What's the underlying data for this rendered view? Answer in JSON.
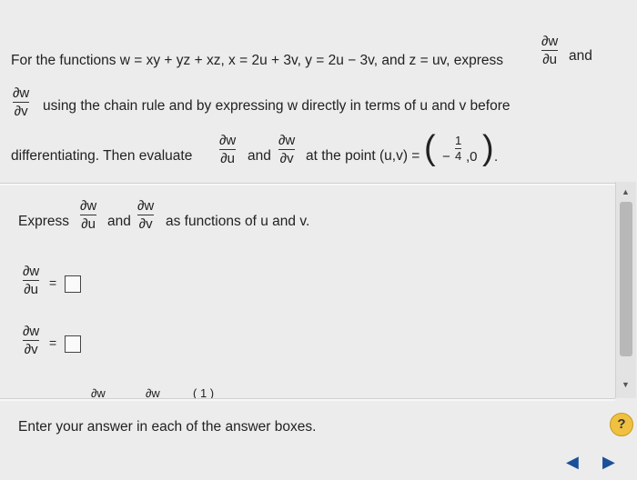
{
  "question": {
    "line1": "For the functions w = xy + yz + xz, x = 2u + 3v, y = 2u − 3v, and z = uv, express",
    "and1": "and",
    "line2": "using the chain rule and by expressing w directly in terms of u and v before",
    "line3_prefix": "differentiating. Then evaluate",
    "and2": "and",
    "line3_suffix": "at the point (u,v) =",
    "point_neg": "−",
    "point_num": "1",
    "point_den": "4",
    "point_rest": ",0",
    "dw": "∂w",
    "du": "∂u",
    "dv": "∂v"
  },
  "part": {
    "express": "Express",
    "and": "and",
    "suffix": "as functions of u and v.",
    "eq": "="
  },
  "partial_next": {
    "dw1": "∂w",
    "dw2": "∂w",
    "paren": "(   1  )"
  },
  "instructions": "Enter your answer in each of the answer boxes.",
  "help_label": "?",
  "nav": {
    "prev": "◀",
    "next": "▶"
  },
  "scroll": {
    "up": "▲",
    "down": "▼"
  }
}
